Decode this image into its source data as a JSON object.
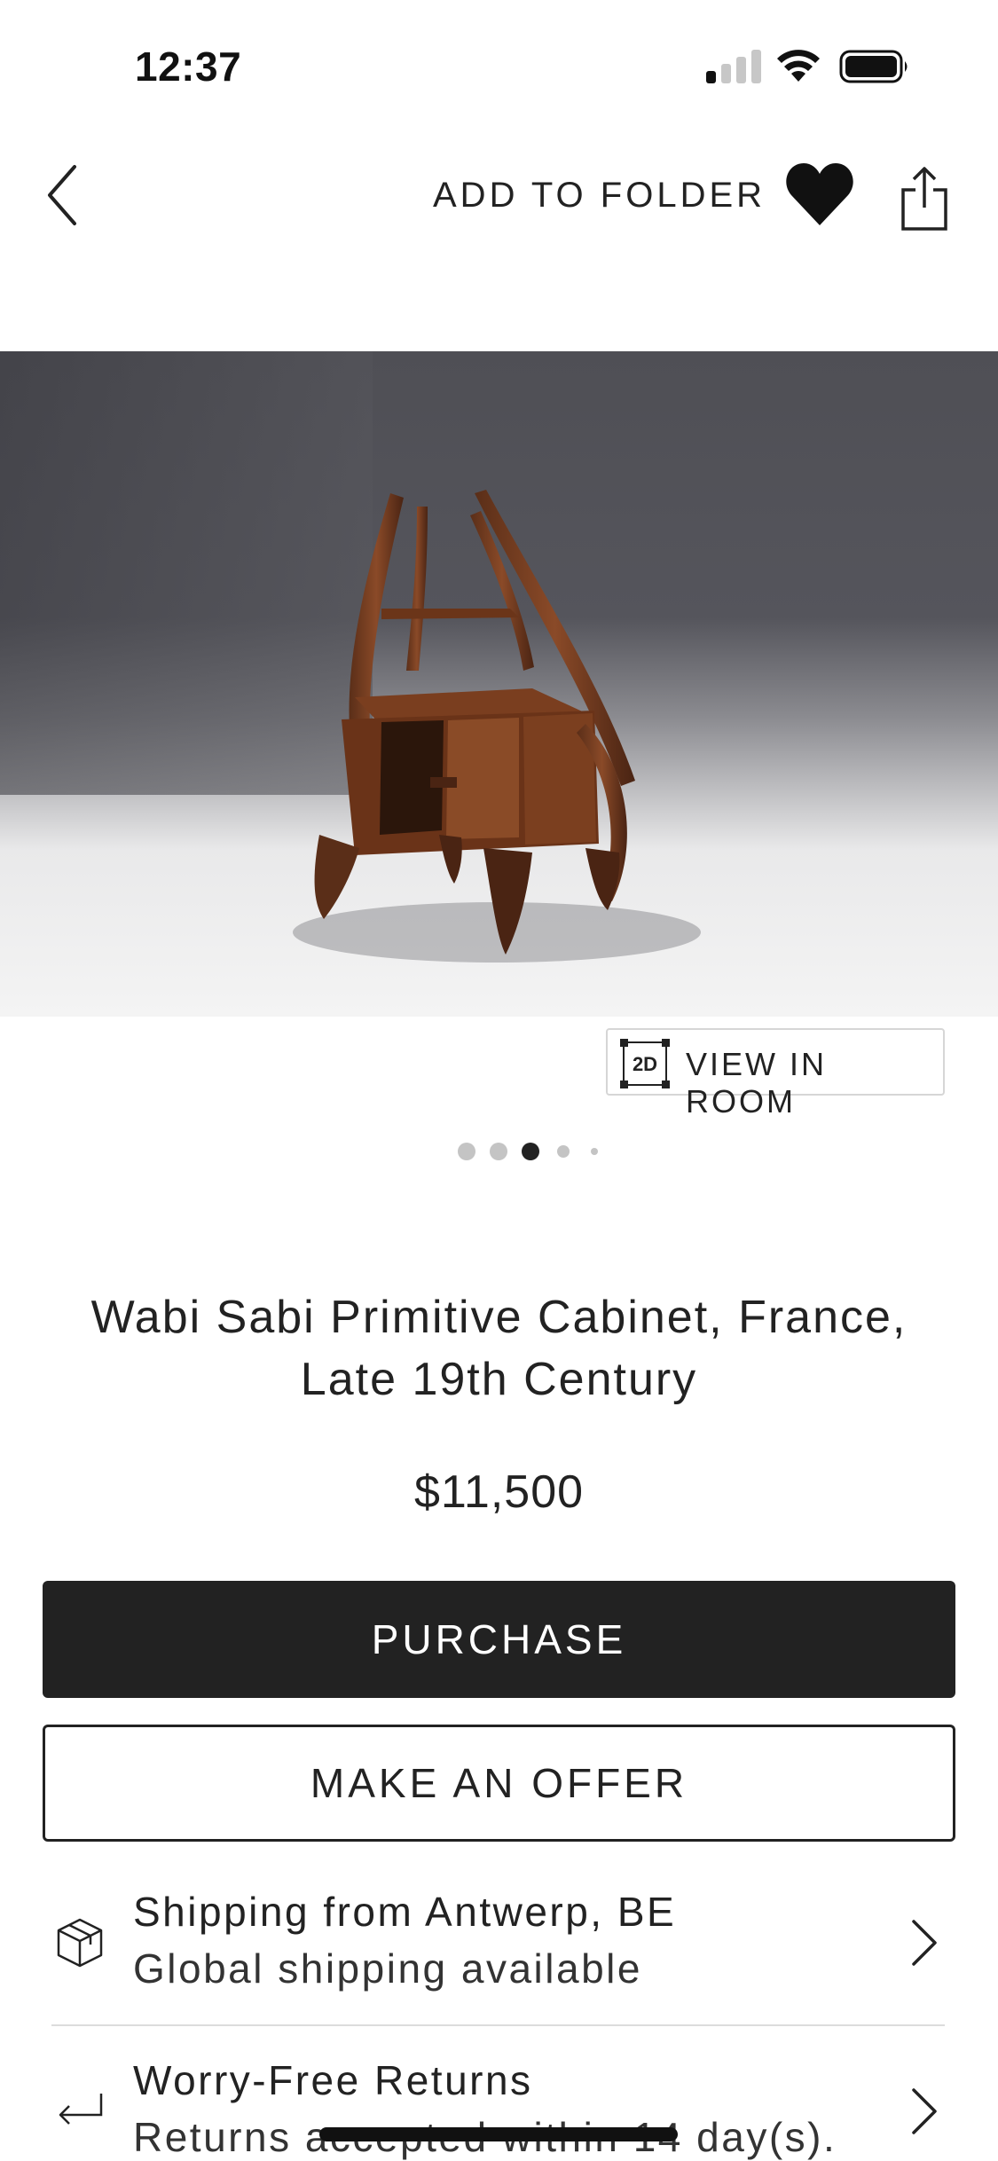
{
  "status_bar": {
    "time": "12:37",
    "signal_bars_active": 1,
    "signal_bars_total": 4
  },
  "top_nav": {
    "back_icon": "chevron-left-icon",
    "add_to_folder_label": "ADD TO FOLDER",
    "favorite_icon": "heart-icon",
    "share_icon": "share-icon"
  },
  "hero": {
    "image_subject": "wooden primitive cabinet on gray backdrop",
    "view_in_room_icon_text": "2D",
    "view_in_room_label": "VIEW IN ROOM",
    "carousel_active_index": 2,
    "carousel_visible_dots": 5
  },
  "product": {
    "title": "Wabi Sabi Primitive Cabinet, France, Late 19th Century",
    "price": "$11,500"
  },
  "actions": {
    "purchase_label": "PURCHASE",
    "offer_label": "MAKE AN OFFER"
  },
  "info": [
    {
      "icon": "box-icon",
      "title": "Shipping from Antwerp, BE",
      "subtitle": "Global shipping available"
    },
    {
      "icon": "return-arrow-icon",
      "title": "Worry-Free Returns",
      "subtitle": "Returns accepted within 14 day(s)."
    }
  ],
  "colors": {
    "primary_button": "#222222",
    "background": "#ffffff",
    "text": "#222222",
    "divider": "#dcdcdc"
  }
}
